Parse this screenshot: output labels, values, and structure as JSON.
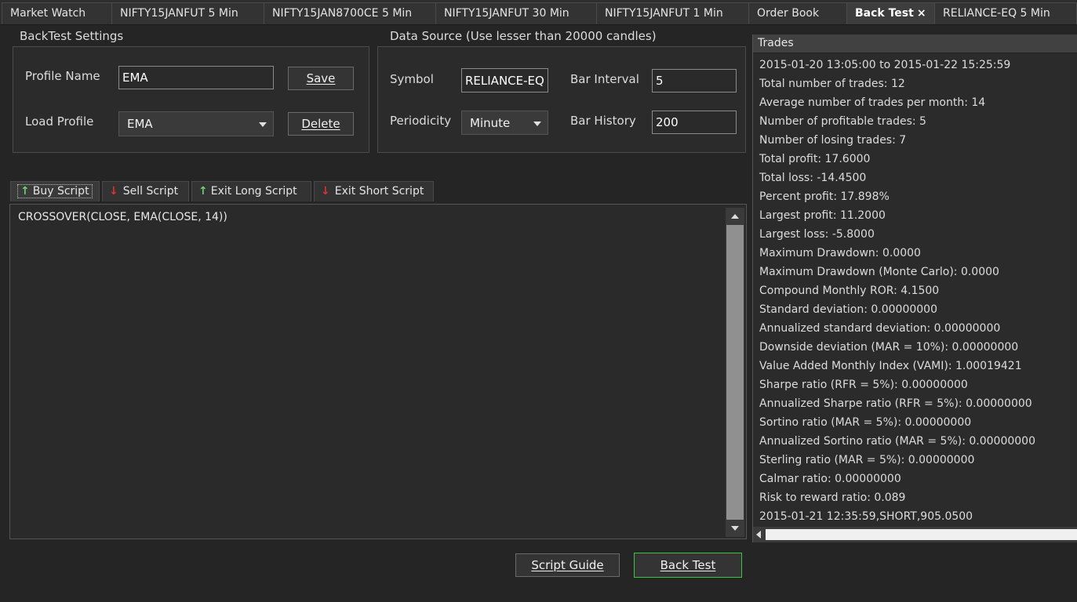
{
  "tabs": [
    {
      "label": "Market Watch",
      "active": false
    },
    {
      "label": "NIFTY15JANFUT 5 Min",
      "active": false
    },
    {
      "label": "NIFTY15JAN8700CE 5 Min",
      "active": false
    },
    {
      "label": "NIFTY15JANFUT 30 Min",
      "active": false
    },
    {
      "label": "NIFTY15JANFUT 1 Min",
      "active": false
    },
    {
      "label": "Order Book",
      "active": false
    },
    {
      "label": "Back Test",
      "active": true,
      "close": "×"
    },
    {
      "label": "RELIANCE-EQ 5 Min",
      "active": false
    }
  ],
  "settings": {
    "title": "BackTest Settings",
    "profile_name_label": "Profile Name",
    "profile_name_value": "EMA",
    "save_label": "Save",
    "load_profile_label": "Load Profile",
    "load_profile_value": "EMA",
    "delete_label": "Delete"
  },
  "datasource": {
    "title": "Data Source (Use lesser than 20000 candles)",
    "symbol_label": "Symbol",
    "symbol_value": "RELIANCE-EQ",
    "periodicity_label": "Periodicity",
    "periodicity_value": "Minute",
    "bar_interval_label": "Bar Interval",
    "bar_interval_value": "5",
    "bar_history_label": "Bar History",
    "bar_history_value": "200"
  },
  "script_tabs": [
    {
      "label": "Buy Script",
      "icon": "arrow-up-icon",
      "active": true
    },
    {
      "label": "Sell Script",
      "icon": "arrow-down-icon",
      "active": false
    },
    {
      "label": "Exit Long Script",
      "icon": "arrow-up-icon",
      "active": false
    },
    {
      "label": "Exit Short Script",
      "icon": "arrow-down-icon",
      "active": false
    }
  ],
  "script_text": "CROSSOVER(CLOSE, EMA(CLOSE, 14))",
  "trades": {
    "header": "Trades",
    "lines": [
      "2015-01-20 13:05:00 to 2015-01-22 15:25:59",
      "Total number of trades: 12",
      "Average number of trades per month: 14",
      "Number of profitable trades: 5",
      "Number of losing trades: 7",
      "Total profit: 17.6000",
      "Total loss: -14.4500",
      "Percent profit: 17.898%",
      "Largest profit: 11.2000",
      "Largest loss: -5.8000",
      "Maximum Drawdown: 0.0000",
      "Maximum Drawdown (Monte Carlo): 0.0000",
      "Compound Monthly ROR: 4.1500",
      "Standard deviation: 0.00000000",
      "Annualized standard deviation: 0.00000000",
      "Downside deviation (MAR = 10%): 0.00000000",
      "Value Added Monthly Index (VAMI): 1.00019421",
      "Sharpe ratio (RFR = 5%): 0.00000000",
      "Annualized Sharpe ratio (RFR = 5%): 0.00000000",
      "Sortino ratio (MAR = 5%): 0.00000000",
      "Annualized Sortino ratio (MAR = 5%): 0.00000000",
      "Sterling ratio (MAR = 5%): 0.00000000",
      "Calmar ratio: 0.00000000",
      "Risk to reward ratio: 0.089",
      "2015-01-21 12:35:59,SHORT,905.0500"
    ]
  },
  "footer": {
    "script_guide_label": "Script Guide",
    "back_test_label": "Back Test"
  },
  "colors": {
    "background": "#252525",
    "primary_button_border": "#3cc43c",
    "up_arrow": "#6fd26f",
    "down_arrow": "#e03030"
  }
}
